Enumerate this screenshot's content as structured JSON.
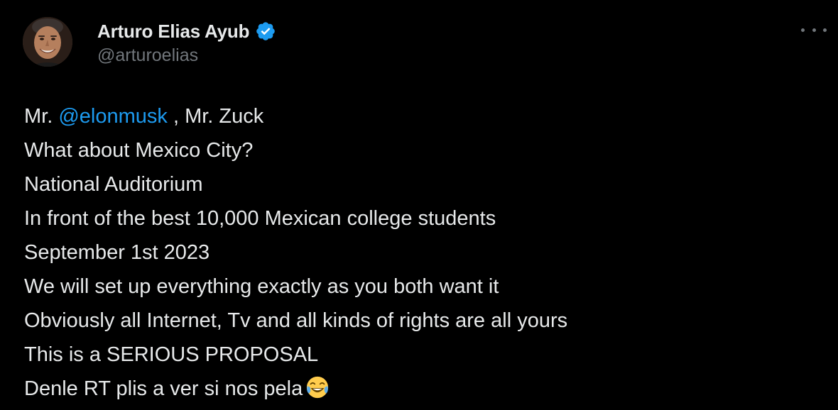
{
  "author": {
    "display_name": "Arturo Elias Ayub",
    "handle": "@arturoelias",
    "verified": true,
    "avatar_icon": "avatar-photo"
  },
  "menu": {
    "icon": "more-icon"
  },
  "tweet": {
    "line1": {
      "prefix": "Mr. ",
      "mention": "@elonmusk",
      "suffix": " , Mr. Zuck"
    },
    "lines": [
      "What about Mexico City?",
      "National Auditorium",
      "In front of the best 10,000 Mexican college students",
      "September 1st 2023",
      "We will set up everything exactly as you both want it",
      "Obviously all Internet, Tv and all kinds of rights are all yours",
      "This is a SERIOUS PROPOSAL"
    ],
    "last_line": "Denle RT plis a ver si nos pela",
    "last_line_emoji": "face-with-tears-of-joy-icon"
  },
  "colors": {
    "background": "#000000",
    "text": "#e7e9ea",
    "secondary": "#71767b",
    "link": "#1d9bf0",
    "verified": "#1d9bf0"
  }
}
